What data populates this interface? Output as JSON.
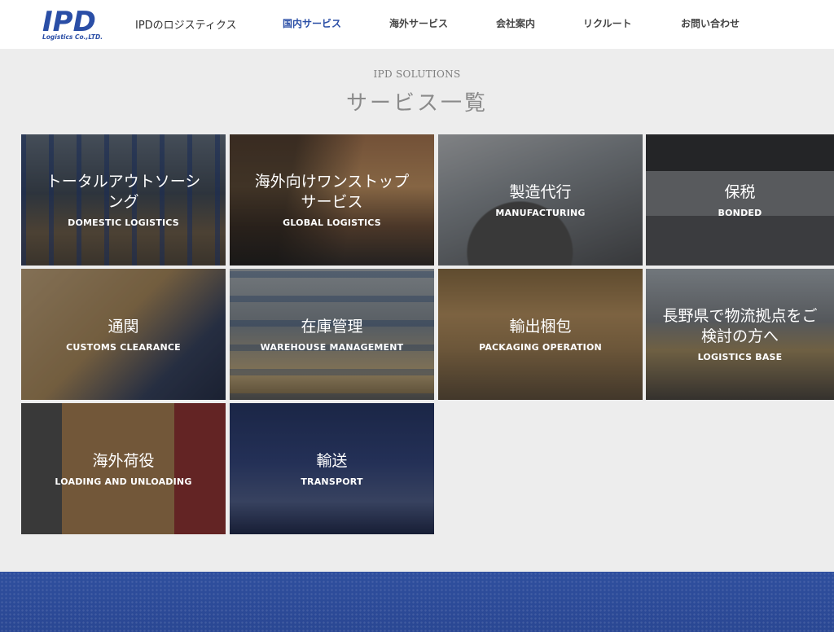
{
  "brand": {
    "logo_text": "IPD",
    "logo_sub": "Logistics Co.,LTD.",
    "site_name": "IPDのロジスティクス",
    "colors": {
      "logo": "#2a4ea6",
      "nav_active": "#2a4ea6",
      "band": "#2f4f9e"
    }
  },
  "nav": [
    {
      "label": "国内サービス",
      "active": true
    },
    {
      "label": "海外サービス",
      "active": false
    },
    {
      "label": "会社案内",
      "active": false
    },
    {
      "label": "リクルート",
      "active": false
    },
    {
      "label": "お問い合わせ",
      "active": false
    }
  ],
  "section": {
    "eyebrow": "IPD SOLUTIONS",
    "title": "サービス一覧"
  },
  "services": [
    {
      "ja": "トータルアウトソーシング",
      "en": "DOMESTIC LOGISTICS"
    },
    {
      "ja": "海外向けワンストップサービス",
      "en": "GLOBAL LOGISTICS"
    },
    {
      "ja": "製造代行",
      "en": "MANUFACTURING"
    },
    {
      "ja": "保税",
      "en": "BONDED"
    },
    {
      "ja": "通関",
      "en": "CUSTOMS CLEARANCE"
    },
    {
      "ja": "在庫管理",
      "en": "WAREHOUSE MANAGEMENT"
    },
    {
      "ja": "輸出梱包",
      "en": "PACKAGING OPERATION"
    },
    {
      "ja": "長野県で物流拠点をご検討の方へ",
      "en": "LOGISTICS BASE"
    },
    {
      "ja": "海外荷役",
      "en": "LOADING AND UNLOADING"
    },
    {
      "ja": "輸送",
      "en": "TRANSPORT"
    }
  ]
}
